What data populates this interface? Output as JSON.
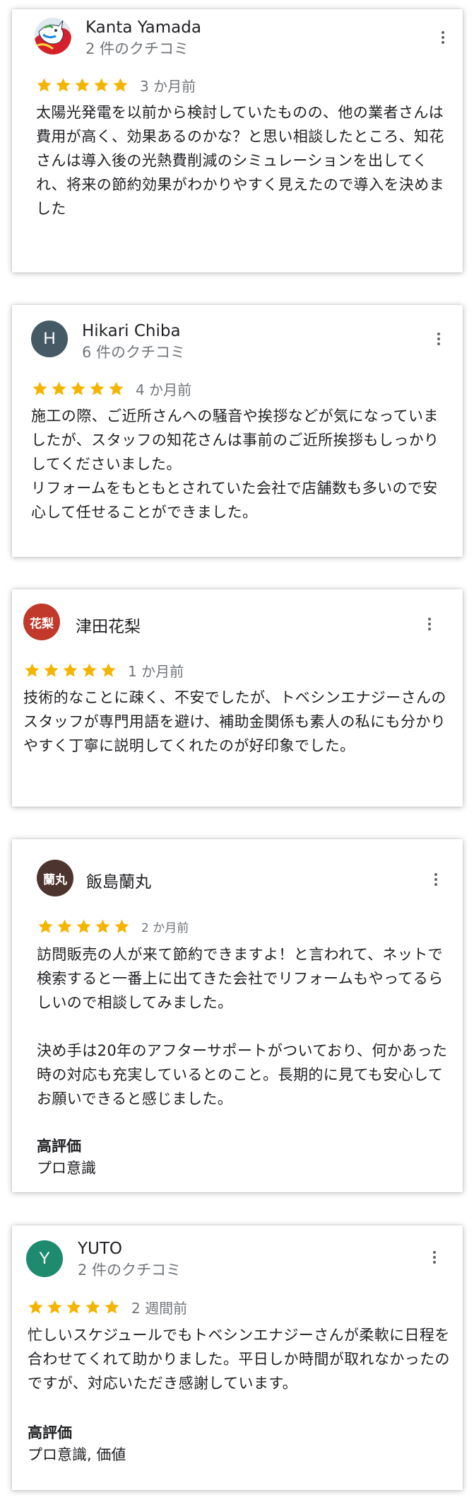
{
  "colors": {
    "star": "#f4b400",
    "meta": "#70757a",
    "text": "#202124"
  },
  "reviews": [
    {
      "author": "Kanta Yamada",
      "meta": "2 件のクチコミ",
      "rating": 5,
      "date": "3 か月前",
      "text": "太陽光発電を以前から検討していたものの、他の業者さんは\n費用が高く、効果あるのかな？と思い相談したところ、知花さんは導入後の光熱費削減のシミュレーションを出してくれ、将来の節約効果がわかりやすく見えたので導入を決めました",
      "avatar_icon": "unicorn-photo-avatar",
      "more_icon": "more-vert-icon"
    },
    {
      "author": "Hikari Chiba",
      "meta": "6 件のクチコミ",
      "rating": 5,
      "date": "4 か月前",
      "text": "施工の際、ご近所さんへの騒音や挨拶などが気になっていましたが、スタッフの知花さんは事前のご近所挨拶もしっかりしてくださいました。\nリフォームをもともとされていた会社で店舗数も多いので安心して任せることができました。",
      "avatar_letter": "H",
      "avatar_color": "#455a64",
      "more_icon": "more-vert-icon"
    },
    {
      "author": "津田花梨",
      "rating": 5,
      "date": "1 か月前",
      "text": "技術的なことに疎く、不安でしたが、トベシンエナジーさんのスタッフが専門用語を避け、補助金関係も素人の私にも分かりやすく丁寧に説明してくれたのが好印象でした。",
      "avatar_text": "花梨",
      "avatar_color": "#c0392b",
      "more_icon": "more-vert-icon"
    },
    {
      "author": "飯島蘭丸",
      "rating": 5,
      "date": "2 か月前",
      "text": "訪問販売の人が来て節約できますよ！と言われて、ネットで検索すると一番上に出てきた会社でリフォームもやってるらしいので相談してみました。\n\n決め手は20年のアフターサポートがついており、何かあった時の対応も充実しているとのこと。長期的に見ても安心してお願いできると感じました。",
      "highlight_title": "高評価",
      "highlight_value": "プロ意識",
      "avatar_text": "蘭丸",
      "avatar_color": "#4e342e",
      "more_icon": "more-vert-icon"
    },
    {
      "author": "YUTO",
      "meta": "2 件のクチコミ",
      "rating": 5,
      "date": "2 週間前",
      "text": "忙しいスケジュールでもトベシンエナジーさんが柔軟に日程を合わせてくれて助かりました。平日しか時間が取れなかったのですが、対応いただき感謝しています。",
      "highlight_title": "高評価",
      "highlight_value": "プロ意識, 価値",
      "avatar_letter": "Y",
      "avatar_color": "#1e8a6e",
      "more_icon": "more-vert-icon"
    }
  ]
}
